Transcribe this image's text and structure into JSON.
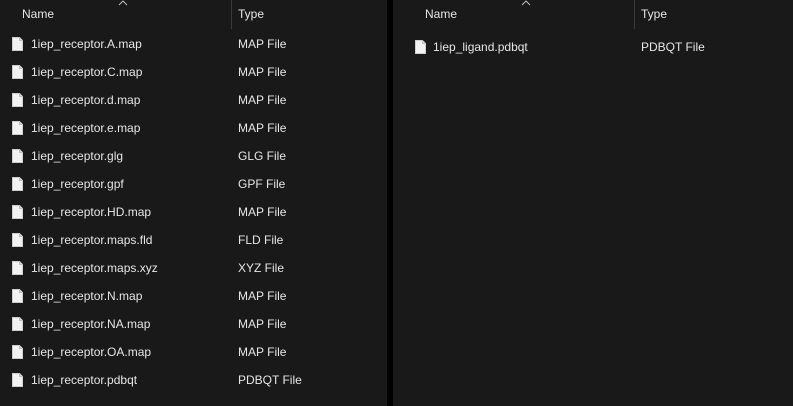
{
  "left_pane": {
    "columns": {
      "name": "Name",
      "type": "Type"
    },
    "files": [
      {
        "name": "1iep_receptor.A.map",
        "type": "MAP File"
      },
      {
        "name": "1iep_receptor.C.map",
        "type": "MAP File"
      },
      {
        "name": "1iep_receptor.d.map",
        "type": "MAP File"
      },
      {
        "name": "1iep_receptor.e.map",
        "type": "MAP File"
      },
      {
        "name": "1iep_receptor.glg",
        "type": "GLG File"
      },
      {
        "name": "1iep_receptor.gpf",
        "type": "GPF File"
      },
      {
        "name": "1iep_receptor.HD.map",
        "type": "MAP File"
      },
      {
        "name": "1iep_receptor.maps.fld",
        "type": "FLD File"
      },
      {
        "name": "1iep_receptor.maps.xyz",
        "type": "XYZ File"
      },
      {
        "name": "1iep_receptor.N.map",
        "type": "MAP File"
      },
      {
        "name": "1iep_receptor.NA.map",
        "type": "MAP File"
      },
      {
        "name": "1iep_receptor.OA.map",
        "type": "MAP File"
      },
      {
        "name": "1iep_receptor.pdbqt",
        "type": "PDBQT File"
      }
    ]
  },
  "right_pane": {
    "columns": {
      "name": "Name",
      "type": "Type"
    },
    "files": [
      {
        "name": "1iep_ligand.pdbqt",
        "type": "PDBQT File"
      }
    ]
  },
  "icons": {
    "file": "file-icon",
    "sort": "sort-ascending-icon"
  },
  "colors": {
    "background": "#191919",
    "text": "#e6e6e6",
    "divider": "#000000"
  }
}
